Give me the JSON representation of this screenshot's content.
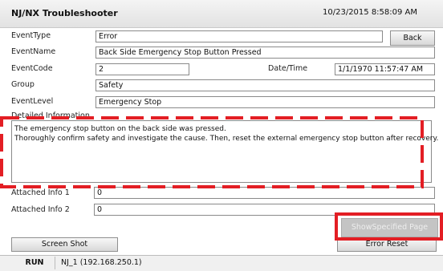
{
  "app": {
    "title": "NJ/NX Troubleshooter",
    "datetime": "10/23/2015 8:58:09 AM"
  },
  "buttons": {
    "back": "Back",
    "show_specified_page": "ShowSpecified Page",
    "screen_shot": "Screen Shot",
    "error_reset": "Error Reset"
  },
  "fields": {
    "event_type": {
      "label": "EventType",
      "value": "Error"
    },
    "event_name": {
      "label": "EventName",
      "value": "Back Side Emergency Stop Button Pressed"
    },
    "event_code": {
      "label": "EventCode",
      "value": "2"
    },
    "date_time": {
      "label": "Date/Time",
      "value": "1/1/1970 11:57:47 AM"
    },
    "group": {
      "label": "Group",
      "value": "Safety"
    },
    "event_level": {
      "label": "EventLevel",
      "value": "Emergency Stop"
    }
  },
  "detail": {
    "label": "Detailed Information",
    "lines": [
      "The emergency stop button on the back side was pressed.",
      "Thoroughly confirm safety and investigate the cause. Then, reset the external emergency stop button after recovery."
    ]
  },
  "attached": [
    {
      "label": "Attached Info 1",
      "value": "0"
    },
    {
      "label": "Attached Info 2",
      "value": "0"
    }
  ],
  "status": {
    "run": "RUN",
    "connection": "NJ_1 (192.168.250.1)"
  },
  "colors": {
    "highlight": "#e31e24",
    "highlight_fill": "#c4c4c4"
  }
}
